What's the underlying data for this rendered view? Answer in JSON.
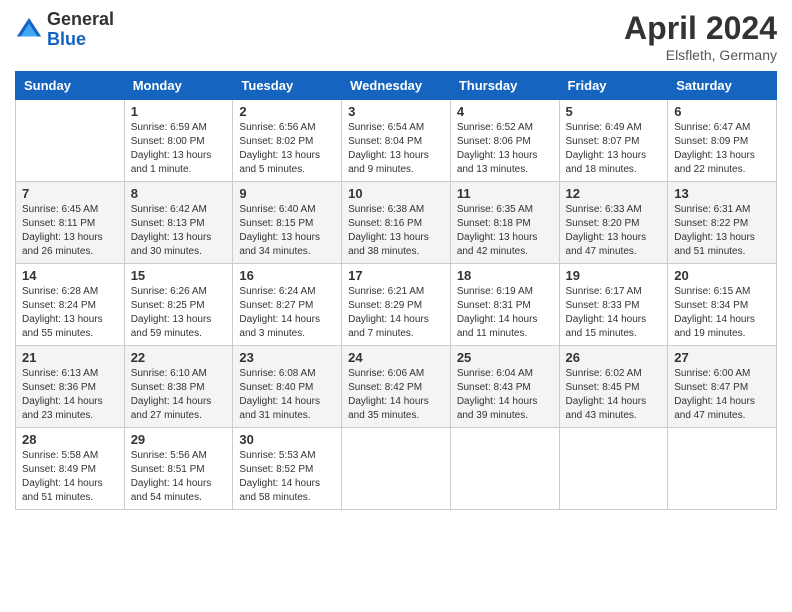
{
  "header": {
    "logo_general": "General",
    "logo_blue": "Blue",
    "month_year": "April 2024",
    "location": "Elsfleth, Germany"
  },
  "weekdays": [
    "Sunday",
    "Monday",
    "Tuesday",
    "Wednesday",
    "Thursday",
    "Friday",
    "Saturday"
  ],
  "weeks": [
    [
      {
        "day": "",
        "sunrise": "",
        "sunset": "",
        "daylight": ""
      },
      {
        "day": "1",
        "sunrise": "Sunrise: 6:59 AM",
        "sunset": "Sunset: 8:00 PM",
        "daylight": "Daylight: 13 hours and 1 minute."
      },
      {
        "day": "2",
        "sunrise": "Sunrise: 6:56 AM",
        "sunset": "Sunset: 8:02 PM",
        "daylight": "Daylight: 13 hours and 5 minutes."
      },
      {
        "day": "3",
        "sunrise": "Sunrise: 6:54 AM",
        "sunset": "Sunset: 8:04 PM",
        "daylight": "Daylight: 13 hours and 9 minutes."
      },
      {
        "day": "4",
        "sunrise": "Sunrise: 6:52 AM",
        "sunset": "Sunset: 8:06 PM",
        "daylight": "Daylight: 13 hours and 13 minutes."
      },
      {
        "day": "5",
        "sunrise": "Sunrise: 6:49 AM",
        "sunset": "Sunset: 8:07 PM",
        "daylight": "Daylight: 13 hours and 18 minutes."
      },
      {
        "day": "6",
        "sunrise": "Sunrise: 6:47 AM",
        "sunset": "Sunset: 8:09 PM",
        "daylight": "Daylight: 13 hours and 22 minutes."
      }
    ],
    [
      {
        "day": "7",
        "sunrise": "Sunrise: 6:45 AM",
        "sunset": "Sunset: 8:11 PM",
        "daylight": "Daylight: 13 hours and 26 minutes."
      },
      {
        "day": "8",
        "sunrise": "Sunrise: 6:42 AM",
        "sunset": "Sunset: 8:13 PM",
        "daylight": "Daylight: 13 hours and 30 minutes."
      },
      {
        "day": "9",
        "sunrise": "Sunrise: 6:40 AM",
        "sunset": "Sunset: 8:15 PM",
        "daylight": "Daylight: 13 hours and 34 minutes."
      },
      {
        "day": "10",
        "sunrise": "Sunrise: 6:38 AM",
        "sunset": "Sunset: 8:16 PM",
        "daylight": "Daylight: 13 hours and 38 minutes."
      },
      {
        "day": "11",
        "sunrise": "Sunrise: 6:35 AM",
        "sunset": "Sunset: 8:18 PM",
        "daylight": "Daylight: 13 hours and 42 minutes."
      },
      {
        "day": "12",
        "sunrise": "Sunrise: 6:33 AM",
        "sunset": "Sunset: 8:20 PM",
        "daylight": "Daylight: 13 hours and 47 minutes."
      },
      {
        "day": "13",
        "sunrise": "Sunrise: 6:31 AM",
        "sunset": "Sunset: 8:22 PM",
        "daylight": "Daylight: 13 hours and 51 minutes."
      }
    ],
    [
      {
        "day": "14",
        "sunrise": "Sunrise: 6:28 AM",
        "sunset": "Sunset: 8:24 PM",
        "daylight": "Daylight: 13 hours and 55 minutes."
      },
      {
        "day": "15",
        "sunrise": "Sunrise: 6:26 AM",
        "sunset": "Sunset: 8:25 PM",
        "daylight": "Daylight: 13 hours and 59 minutes."
      },
      {
        "day": "16",
        "sunrise": "Sunrise: 6:24 AM",
        "sunset": "Sunset: 8:27 PM",
        "daylight": "Daylight: 14 hours and 3 minutes."
      },
      {
        "day": "17",
        "sunrise": "Sunrise: 6:21 AM",
        "sunset": "Sunset: 8:29 PM",
        "daylight": "Daylight: 14 hours and 7 minutes."
      },
      {
        "day": "18",
        "sunrise": "Sunrise: 6:19 AM",
        "sunset": "Sunset: 8:31 PM",
        "daylight": "Daylight: 14 hours and 11 minutes."
      },
      {
        "day": "19",
        "sunrise": "Sunrise: 6:17 AM",
        "sunset": "Sunset: 8:33 PM",
        "daylight": "Daylight: 14 hours and 15 minutes."
      },
      {
        "day": "20",
        "sunrise": "Sunrise: 6:15 AM",
        "sunset": "Sunset: 8:34 PM",
        "daylight": "Daylight: 14 hours and 19 minutes."
      }
    ],
    [
      {
        "day": "21",
        "sunrise": "Sunrise: 6:13 AM",
        "sunset": "Sunset: 8:36 PM",
        "daylight": "Daylight: 14 hours and 23 minutes."
      },
      {
        "day": "22",
        "sunrise": "Sunrise: 6:10 AM",
        "sunset": "Sunset: 8:38 PM",
        "daylight": "Daylight: 14 hours and 27 minutes."
      },
      {
        "day": "23",
        "sunrise": "Sunrise: 6:08 AM",
        "sunset": "Sunset: 8:40 PM",
        "daylight": "Daylight: 14 hours and 31 minutes."
      },
      {
        "day": "24",
        "sunrise": "Sunrise: 6:06 AM",
        "sunset": "Sunset: 8:42 PM",
        "daylight": "Daylight: 14 hours and 35 minutes."
      },
      {
        "day": "25",
        "sunrise": "Sunrise: 6:04 AM",
        "sunset": "Sunset: 8:43 PM",
        "daylight": "Daylight: 14 hours and 39 minutes."
      },
      {
        "day": "26",
        "sunrise": "Sunrise: 6:02 AM",
        "sunset": "Sunset: 8:45 PM",
        "daylight": "Daylight: 14 hours and 43 minutes."
      },
      {
        "day": "27",
        "sunrise": "Sunrise: 6:00 AM",
        "sunset": "Sunset: 8:47 PM",
        "daylight": "Daylight: 14 hours and 47 minutes."
      }
    ],
    [
      {
        "day": "28",
        "sunrise": "Sunrise: 5:58 AM",
        "sunset": "Sunset: 8:49 PM",
        "daylight": "Daylight: 14 hours and 51 minutes."
      },
      {
        "day": "29",
        "sunrise": "Sunrise: 5:56 AM",
        "sunset": "Sunset: 8:51 PM",
        "daylight": "Daylight: 14 hours and 54 minutes."
      },
      {
        "day": "30",
        "sunrise": "Sunrise: 5:53 AM",
        "sunset": "Sunset: 8:52 PM",
        "daylight": "Daylight: 14 hours and 58 minutes."
      },
      {
        "day": "",
        "sunrise": "",
        "sunset": "",
        "daylight": ""
      },
      {
        "day": "",
        "sunrise": "",
        "sunset": "",
        "daylight": ""
      },
      {
        "day": "",
        "sunrise": "",
        "sunset": "",
        "daylight": ""
      },
      {
        "day": "",
        "sunrise": "",
        "sunset": "",
        "daylight": ""
      }
    ]
  ]
}
